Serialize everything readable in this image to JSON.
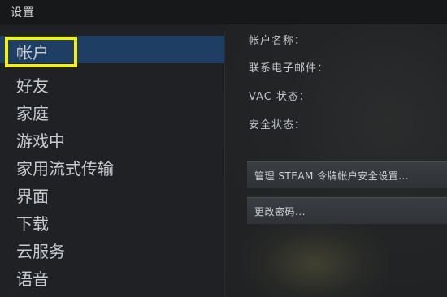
{
  "window": {
    "title": "设置"
  },
  "sidebar": {
    "items": [
      {
        "label": "帐户",
        "active": true
      },
      {
        "label": "好友",
        "active": false
      },
      {
        "label": "家庭",
        "active": false
      },
      {
        "label": "游戏中",
        "active": false
      },
      {
        "label": "家用流式传输",
        "active": false
      },
      {
        "label": "界面",
        "active": false
      },
      {
        "label": "下载",
        "active": false
      },
      {
        "label": "云服务",
        "active": false
      },
      {
        "label": "语音",
        "active": false
      }
    ]
  },
  "account": {
    "fields": [
      {
        "label": "帐户名称："
      },
      {
        "label": "联系电子邮件："
      },
      {
        "label": "VAC 状态："
      },
      {
        "label": "安全状态："
      }
    ],
    "buttons": [
      {
        "label": "管理 STEAM 令牌帐户安全设置..."
      },
      {
        "label": "更改密码..."
      }
    ]
  },
  "colors": {
    "active_item": "#1e3f63",
    "highlight_border": "#f5ef12"
  }
}
